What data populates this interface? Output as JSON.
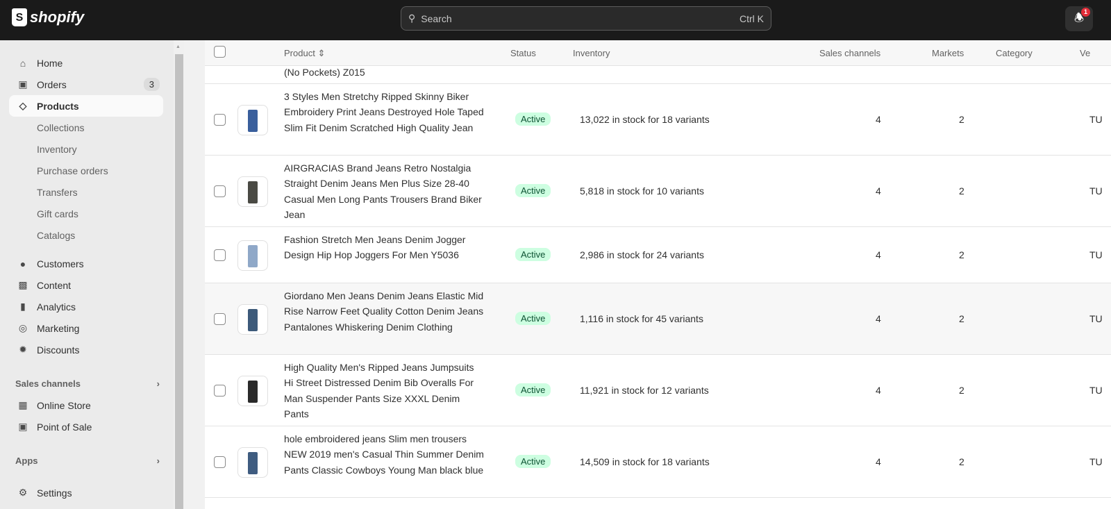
{
  "topbar": {
    "logo": "shopify",
    "search_placeholder": "Search",
    "shortcut": "Ctrl K",
    "notification_count": "1"
  },
  "sidebar": {
    "items": [
      {
        "label": "Home",
        "icon": "home-icon"
      },
      {
        "label": "Orders",
        "icon": "inbox-icon",
        "badge": "3"
      },
      {
        "label": "Products",
        "icon": "tag-icon"
      }
    ],
    "product_sub": [
      "Collections",
      "Inventory",
      "Purchase orders",
      "Transfers",
      "Gift cards",
      "Catalogs"
    ],
    "items2": [
      {
        "label": "Customers"
      },
      {
        "label": "Content"
      },
      {
        "label": "Analytics"
      },
      {
        "label": "Marketing"
      },
      {
        "label": "Discounts"
      }
    ],
    "sales_channels": "Sales channels",
    "channels": [
      "Online Store",
      "Point of Sale"
    ],
    "apps": "Apps",
    "settings": "Settings"
  },
  "table": {
    "headers": {
      "product": "Product",
      "status": "Status",
      "inventory": "Inventory",
      "sales_channels": "Sales channels",
      "markets": "Markets",
      "category": "Category",
      "vendor": "Ve"
    },
    "partial_row": "(No Pockets) Z015",
    "rows": [
      {
        "name": "3 Styles Men Stretchy Ripped Skinny Biker Embroidery Print Jeans Destroyed Hole Taped Slim Fit Denim Scratched High Quality Jean",
        "status": "Active",
        "inventory": "13,022 in stock for 18 variants",
        "channels": "4",
        "markets": "2",
        "vendor": "TU"
      },
      {
        "name": "AIRGRACIAS Brand Jeans Retro Nostalgia Straight Denim Jeans Men Plus Size 28-40 Casual Men Long Pants Trousers Brand Biker Jean",
        "status": "Active",
        "inventory": "5,818 in stock for 10 variants",
        "channels": "4",
        "markets": "2",
        "vendor": "TU"
      },
      {
        "name": "Fashion Stretch Men Jeans Denim Jogger Design Hip Hop Joggers For Men Y5036",
        "status": "Active",
        "inventory": "2,986 in stock for 24 variants",
        "channels": "4",
        "markets": "2",
        "vendor": "TU"
      },
      {
        "name": "Giordano Men Jeans Denim Jeans Elastic Mid Rise Narrow Feet Quality Cotton Denim Jeans Pantalones Whiskering Denim Clothing",
        "status": "Active",
        "inventory": "1,116 in stock for 45 variants",
        "channels": "4",
        "markets": "2",
        "vendor": "TU"
      },
      {
        "name": "High Quality Men's Ripped Jeans Jumpsuits Hi Street Distressed Denim Bib Overalls For Man Suspender Pants Size XXXL Denim Pants",
        "status": "Active",
        "inventory": "11,921 in stock for 12 variants",
        "channels": "4",
        "markets": "2",
        "vendor": "TU"
      },
      {
        "name": "hole embroidered jeans Slim men trousers NEW 2019 men's Casual Thin Summer Denim Pants Classic Cowboys Young Man black blue",
        "status": "Active",
        "inventory": "14,509 in stock for 18 variants",
        "channels": "4",
        "markets": "2",
        "vendor": "TU"
      }
    ]
  }
}
